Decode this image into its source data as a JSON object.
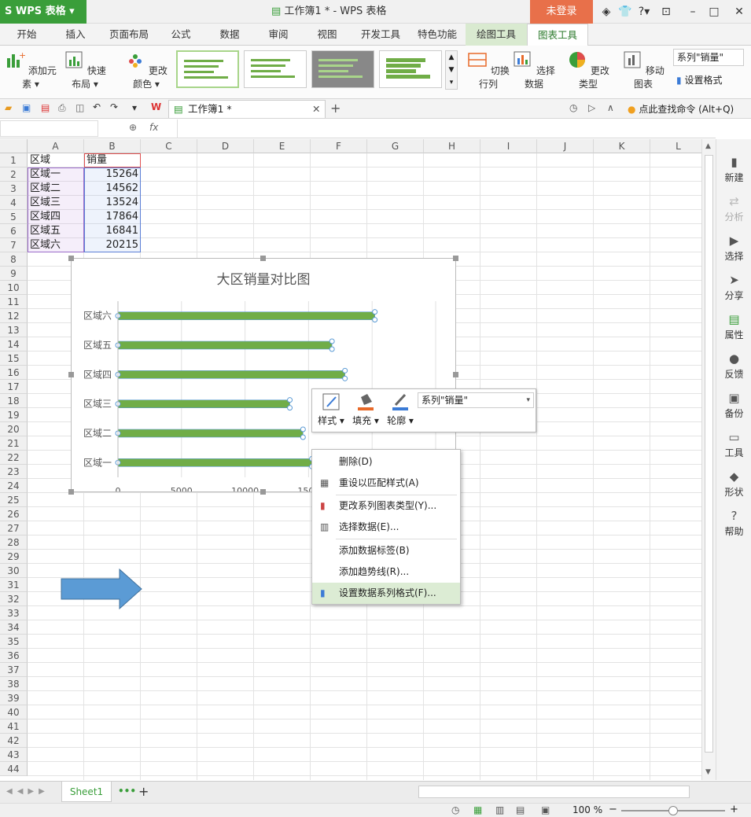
{
  "app": {
    "brand": "WPS 表格",
    "title": "工作簿1 * - WPS 表格",
    "login": "未登录",
    "window_buttons": [
      "minimize-icon",
      "maximize-icon",
      "close-icon"
    ]
  },
  "menu": {
    "tabs": [
      "开始",
      "插入",
      "页面布局",
      "公式",
      "数据",
      "审阅",
      "视图",
      "开发工具",
      "特色功能",
      "绘图工具",
      "图表工具"
    ]
  },
  "ribbon": {
    "add_element": "添加元素",
    "quick_layout": "快速布局",
    "change_color": "更改颜色",
    "switch_rowcol": "切换行列",
    "select_data": "选择数据",
    "change_type": "更改类型",
    "move_chart": "移动图表",
    "series_select": "系列\"销量\"",
    "set_format": "设置格式"
  },
  "quickbar": {
    "doc_tab": "工作簿1 *",
    "search": "点此查找命令 (Alt+Q)"
  },
  "formula": {
    "fx": "fx"
  },
  "grid": {
    "columns": [
      "A",
      "B",
      "C",
      "D",
      "E",
      "F",
      "G",
      "H",
      "I",
      "J",
      "K",
      "L"
    ],
    "rows": [
      "1",
      "2",
      "3",
      "4",
      "5",
      "6",
      "7",
      "8",
      "9",
      "10",
      "11",
      "12",
      "13",
      "14",
      "15",
      "16",
      "17",
      "18",
      "19",
      "20",
      "21",
      "22",
      "23",
      "24",
      "25",
      "26",
      "27",
      "28",
      "29",
      "30",
      "31",
      "32",
      "33",
      "34",
      "35",
      "36",
      "37",
      "38",
      "39",
      "40",
      "41",
      "42",
      "43",
      "44"
    ],
    "header_a": "区域",
    "header_b": "销量",
    "data": [
      {
        "region": "区域一",
        "sales": "15264"
      },
      {
        "region": "区域二",
        "sales": "14562"
      },
      {
        "region": "区域三",
        "sales": "13524"
      },
      {
        "region": "区域四",
        "sales": "17864"
      },
      {
        "region": "区域五",
        "sales": "16841"
      },
      {
        "region": "区域六",
        "sales": "20215"
      }
    ]
  },
  "chart_data": {
    "type": "bar",
    "orientation": "horizontal",
    "title": "大区销量对比图",
    "categories": [
      "区域一",
      "区域二",
      "区域三",
      "区域四",
      "区域五",
      "区域六"
    ],
    "values": [
      15264,
      14562,
      13524,
      17864,
      16841,
      20215
    ],
    "x_ticks": [
      "0",
      "5000",
      "10000",
      "1500"
    ],
    "xlim": [
      0,
      25000
    ],
    "bar_color": "#70ad47",
    "grid": true
  },
  "minibar": {
    "style": "样式",
    "fill": "填充",
    "outline": "轮廓",
    "series": "系列\"销量\""
  },
  "context_menu": {
    "items": [
      "删除(D)",
      "重设以匹配样式(A)",
      "更改系列图表类型(Y)...",
      "选择数据(E)...",
      "添加数据标签(B)",
      "添加趋势线(R)...",
      "设置数据系列格式(F)..."
    ]
  },
  "sidebar": {
    "items": [
      "新建",
      "分析",
      "选择",
      "分享",
      "属性",
      "反馈",
      "备份",
      "工具",
      "形状",
      "帮助"
    ]
  },
  "sheet": {
    "tab": "Sheet1"
  },
  "status": {
    "zoom": "100 %"
  },
  "colors": {
    "brand_green": "#3a9e3a",
    "login_orange": "#e8704a",
    "arrow_blue": "#5b9bd5"
  }
}
